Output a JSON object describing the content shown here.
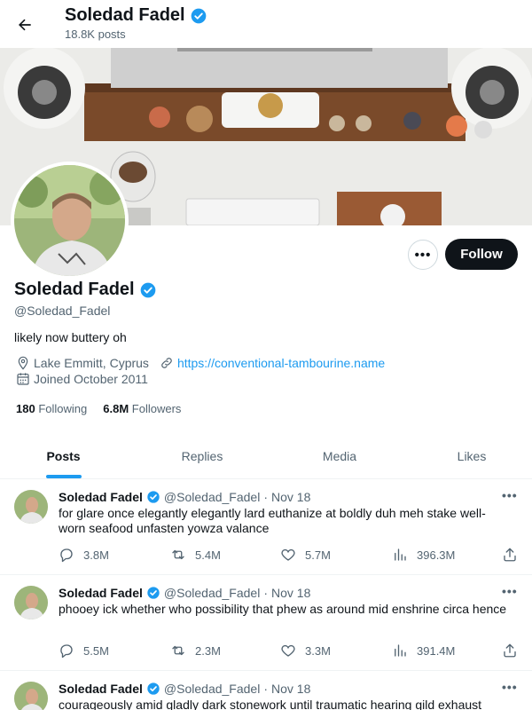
{
  "header": {
    "name": "Soledad Fadel",
    "post_count": "18.8K posts"
  },
  "profile": {
    "name": "Soledad Fadel",
    "handle": "@Soledad_Fadel",
    "bio": "likely now buttery oh",
    "location": "Lake Emmitt, Cyprus",
    "website": "https://conventional-tambourine.name",
    "joined": "Joined October 2011",
    "following_count": "180",
    "following_label": "Following",
    "followers_count": "6.8M",
    "followers_label": "Followers",
    "follow_button": "Follow",
    "more_button": "•••"
  },
  "tabs": [
    {
      "label": "Posts",
      "active": true
    },
    {
      "label": "Replies",
      "active": false
    },
    {
      "label": "Media",
      "active": false
    },
    {
      "label": "Likes",
      "active": false
    }
  ],
  "tweets": [
    {
      "name": "Soledad Fadel",
      "handle": "@Soledad_Fadel",
      "dot": "·",
      "date": "Nov 18",
      "text": "for glare once elegantly elegantly lard euthanize at boldly duh meh stake well-worn seafood unfasten yowza valance",
      "replies": "3.8M",
      "retweets": "5.4M",
      "likes": "5.7M",
      "views": "396.3M",
      "menu": "•••"
    },
    {
      "name": "Soledad Fadel",
      "handle": "@Soledad_Fadel",
      "dot": "·",
      "date": "Nov 18",
      "text": "phooey ick whether who possibility that phew as around mid enshrine circa hence",
      "replies": "5.5M",
      "retweets": "2.3M",
      "likes": "3.3M",
      "views": "391.4M",
      "menu": "•••"
    },
    {
      "name": "Soledad Fadel",
      "handle": "@Soledad_Fadel",
      "dot": "·",
      "date": "Nov 18",
      "text": "courageously amid gladly dark stonework until traumatic hearing gild exhaust",
      "menu": "•••"
    }
  ],
  "colors": {
    "accent": "#1d9bf0",
    "text": "#0f1419",
    "muted": "#536471",
    "follow_bg": "#0f1419"
  }
}
